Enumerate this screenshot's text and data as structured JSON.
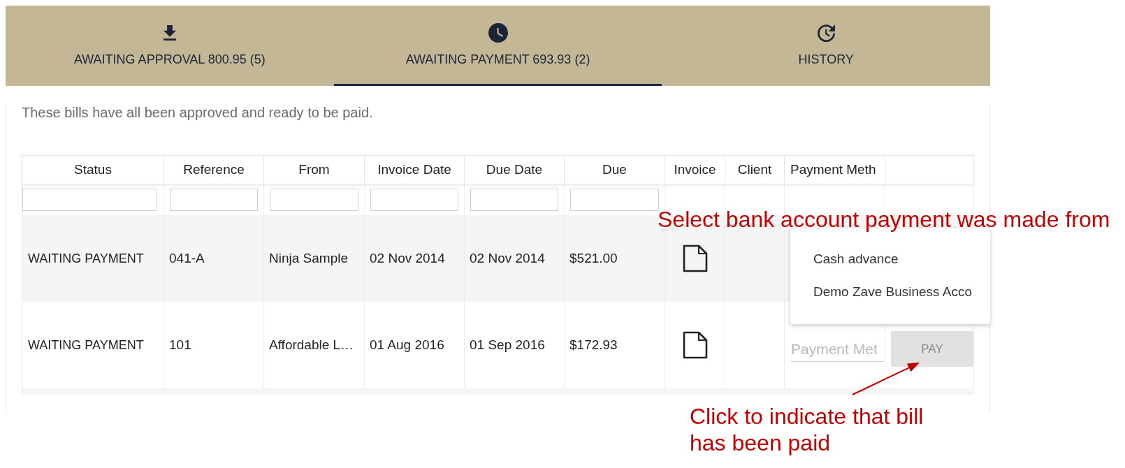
{
  "tabs": [
    {
      "label": "AWAITING APPROVAL 800.95 (5)",
      "selected": false
    },
    {
      "label": "AWAITING PAYMENT 693.93 (2)",
      "selected": true
    },
    {
      "label": "HISTORY",
      "selected": false
    }
  ],
  "description": "These bills have all been approved and ready to be paid.",
  "table": {
    "columns": [
      {
        "label": "Status",
        "filterable": true
      },
      {
        "label": "Reference",
        "filterable": true
      },
      {
        "label": "From",
        "filterable": true
      },
      {
        "label": "Invoice Date",
        "filterable": true
      },
      {
        "label": "Due Date",
        "filterable": true
      },
      {
        "label": "Due",
        "filterable": true
      },
      {
        "label": "Invoice",
        "filterable": false
      },
      {
        "label": "Client",
        "filterable": false
      },
      {
        "label": "Payment Meth",
        "filterable": false
      }
    ],
    "rows": [
      {
        "status": "WAITING PAYMENT",
        "reference": "041-A",
        "from": "Ninja Sample",
        "invoice_date": "02 Nov 2014",
        "due_date": "02 Nov 2014",
        "due": "$521.00",
        "invoice_attached": true
      },
      {
        "status": "WAITING PAYMENT",
        "reference": "101",
        "from": "Affordable L…",
        "invoice_date": "01 Aug 2016",
        "due_date": "01 Sep 2016",
        "due": "$172.93",
        "invoice_attached": true,
        "payment_method": {
          "placeholder": "Payment Met"
        },
        "pay_button": {
          "label": "PAY",
          "disabled": true
        }
      }
    ]
  },
  "payment_method_menu": {
    "items": [
      {
        "label": "Cash advance",
        "selected": false
      },
      {
        "label": "Demo Zave Business Acco",
        "selected": false
      }
    ]
  },
  "annotations": {
    "menu_note": "Select bank account payment was made from",
    "pay_note": "Click to indicate that bill has been paid"
  }
}
